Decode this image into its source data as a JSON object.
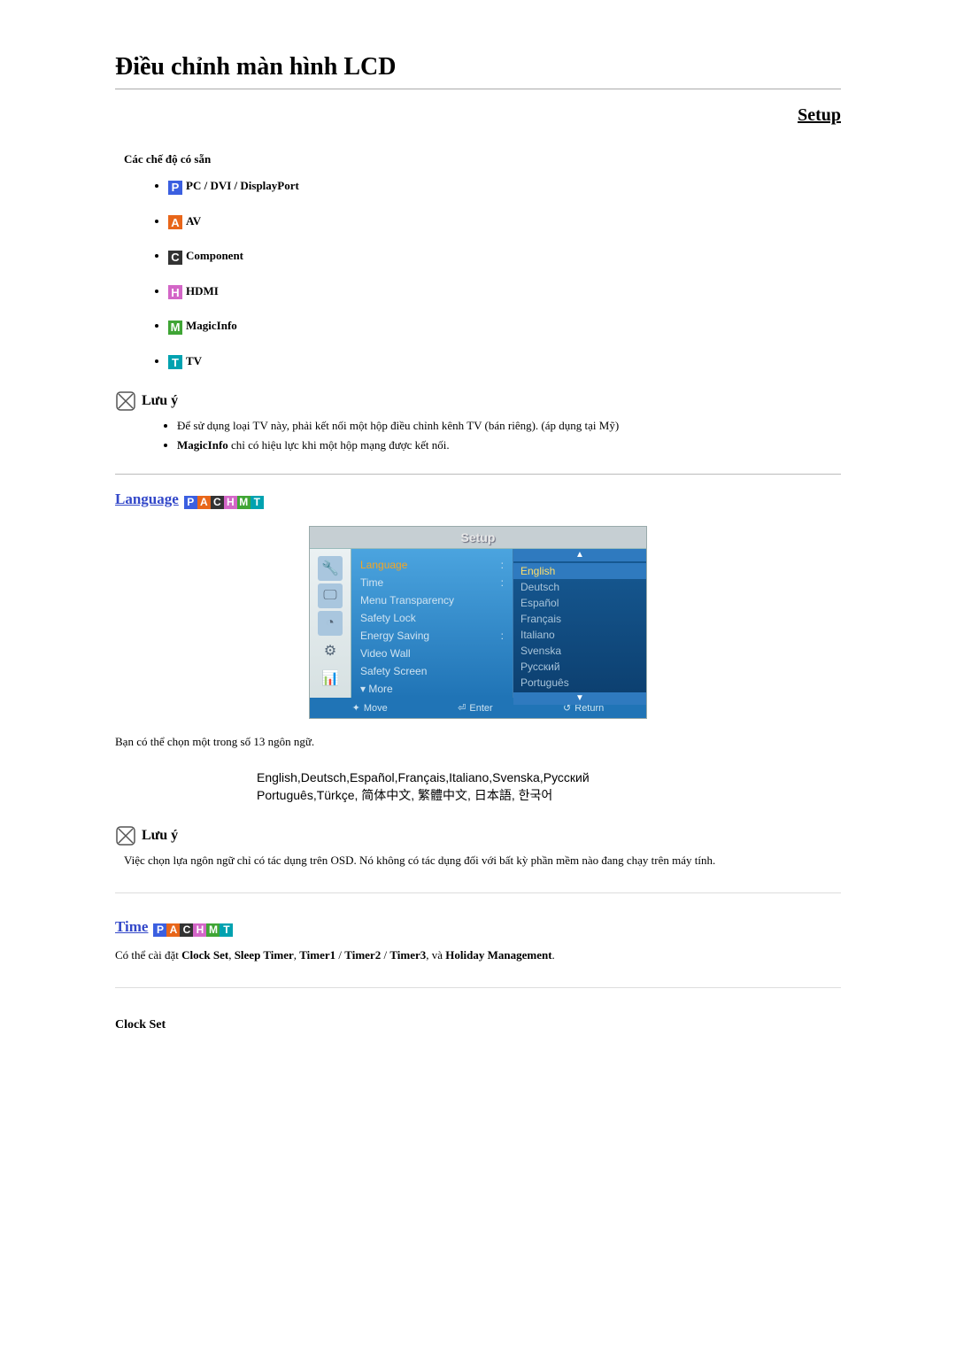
{
  "title": "Điều chỉnh màn hình LCD",
  "setup_link": "Setup",
  "modes": {
    "title": "Các chế độ có sẵn",
    "items": [
      {
        "letter": "P",
        "label": "PC / DVI / DisplayPort",
        "cls": "ic-p"
      },
      {
        "letter": "A",
        "label": "AV",
        "cls": "ic-a"
      },
      {
        "letter": "C",
        "label": "Component",
        "cls": "ic-c"
      },
      {
        "letter": "H",
        "label": "HDMI",
        "cls": "ic-h"
      },
      {
        "letter": "M",
        "label": "MagicInfo",
        "cls": "ic-m"
      },
      {
        "letter": "T",
        "label": "TV",
        "cls": "ic-t"
      }
    ]
  },
  "note_label": "Lưu ý",
  "note1": {
    "items": [
      "Để sử dụng loại TV này, phải kết nối một hộp điều chỉnh kênh TV (bán riêng). (áp dụng tại Mỹ)",
      "MagicInfo chỉ có hiệu lực khi một hộp mạng được kết nối."
    ],
    "bold_in_2": "MagicInfo"
  },
  "language": {
    "title": "Language",
    "badges": [
      "P",
      "A",
      "C",
      "H",
      "M",
      "T"
    ],
    "osd": {
      "title": "Setup",
      "menu": [
        "Language",
        "Time",
        "Menu Transparency",
        "Safety Lock",
        "Energy Saving",
        "Video Wall",
        "Safety Screen",
        "▾ More"
      ],
      "selected_index": 0,
      "options": [
        "English",
        "Deutsch",
        "Español",
        "Français",
        "Italiano",
        "Svenska",
        "Русский",
        "Português"
      ],
      "selected_option_index": 0,
      "footer": {
        "move": "Move",
        "enter": "Enter",
        "return": "Return"
      }
    },
    "description": "Bạn có thể chọn một trong số 13 ngôn ngữ.",
    "lang_line1": "English,Deutsch,Español,Français,Italiano,Svenska,Русский",
    "lang_line2": "Português,Türkçe, 简体中文,  繁體中文, 日本語, 한국어",
    "note": "Việc chọn lựa ngôn ngữ chỉ có tác dụng trên OSD. Nó không có tác dụng đối với bất kỳ phần mềm nào đang chạy trên máy tính."
  },
  "time": {
    "title": "Time",
    "badges": [
      "P",
      "A",
      "C",
      "H",
      "M",
      "T"
    ],
    "description_parts": {
      "prefix": "Có thể cài đặt ",
      "b1": "Clock Set",
      "s1": ", ",
      "b2": "Sleep Timer",
      "s2": ", ",
      "b3": "Timer1",
      "s3": " / ",
      "b4": "Timer2",
      "s4": " / ",
      "b5": "Timer3",
      "s5": ", và ",
      "b6": "Holiday Management",
      "suffix": "."
    },
    "clock_set": "Clock Set"
  }
}
